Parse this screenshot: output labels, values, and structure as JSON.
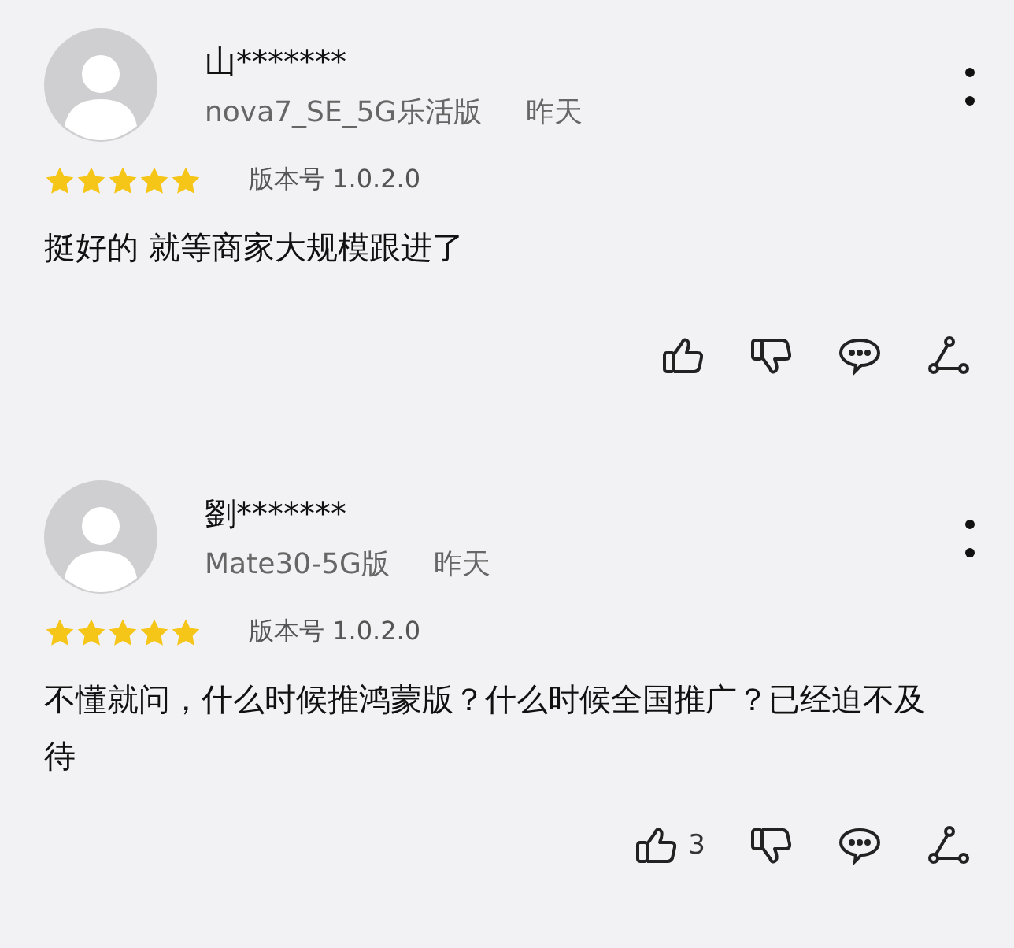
{
  "reviews": [
    {
      "user": "山*******",
      "device": "nova7_SE_5G乐活版",
      "time": "昨天",
      "stars": 5,
      "version": "版本号 1.0.2.0",
      "text": "挺好的  就等商家大规模跟进了"
    },
    {
      "user": "劉*******",
      "device": "Mate30-5G版",
      "time": "昨天",
      "stars": 5,
      "version": "版本号 1.0.2.0",
      "text": "不懂就问，什么时候推鸿蒙版？什么时候全国推广？已经迫不及待",
      "likes": "3"
    }
  ]
}
